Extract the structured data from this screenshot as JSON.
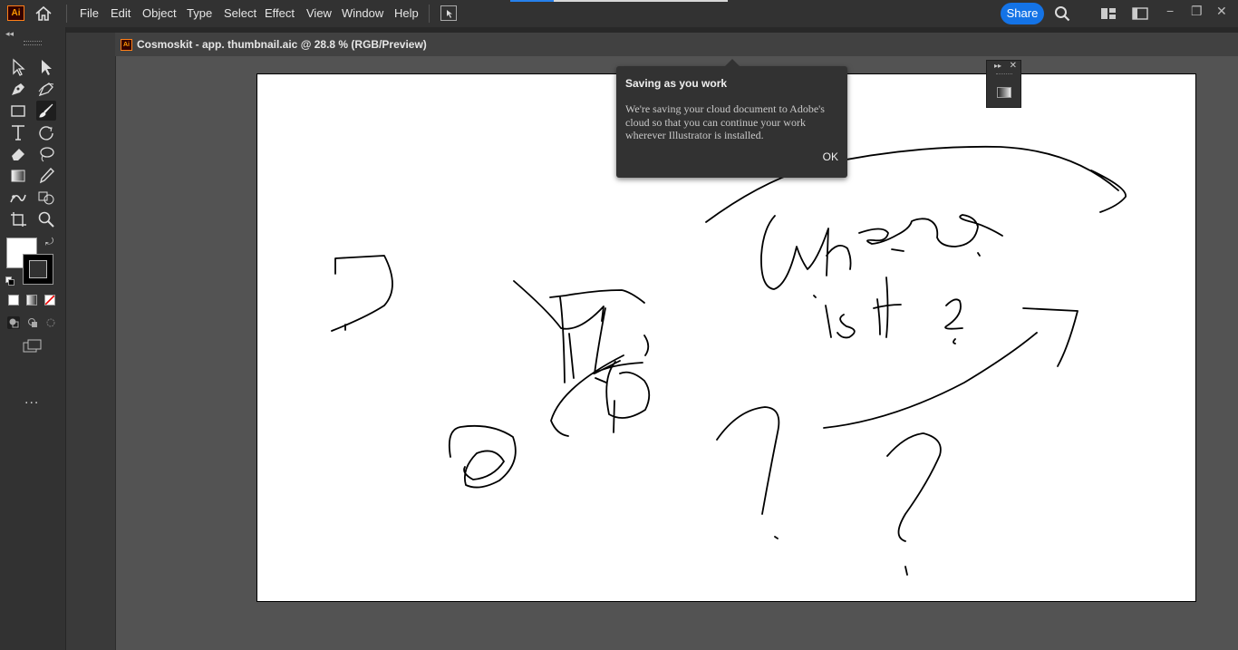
{
  "app": {
    "logo_text": "Ai"
  },
  "menu": [
    "File",
    "Edit",
    "Object",
    "Type",
    "Select",
    "Effect",
    "View",
    "Window",
    "Help"
  ],
  "share_label": "Share",
  "progress": 0.2,
  "window_controls": [
    "−",
    "❐",
    "✕"
  ],
  "document": {
    "tab_icon_text": "Ai",
    "tab_title": "Cosmoskit - app. thumbnail.aic @ 28.8 % (RGB/Preview)"
  },
  "tooltip": {
    "title": "Saving as you work",
    "body": "We're saving your cloud document to Adobe's cloud so that you can continue your work wherever Illustrator is installed.",
    "ok_label": "OK"
  },
  "toolbar": {
    "more_label": "..."
  },
  "colors": {
    "share_blue": "#1473e6",
    "menubar_bg": "#323232",
    "canvas_bg": "#535353",
    "logo_orange": "#ff9a00"
  },
  "tools": [
    "selection-tool-icon",
    "direct-selection-tool-icon",
    "pen-tool-icon",
    "curvature-tool-icon",
    "rectangle-tool-icon",
    "paintbrush-tool-icon",
    "type-tool-icon",
    "rotate-tool-icon",
    "eraser-tool-icon",
    "lasso-tool-icon",
    "gradient-tool-icon",
    "eyedropper-tool-icon",
    "puppet-warp-tool-icon",
    "shape-builder-tool-icon",
    "artboard-tool-icon",
    "zoom-tool-icon"
  ]
}
